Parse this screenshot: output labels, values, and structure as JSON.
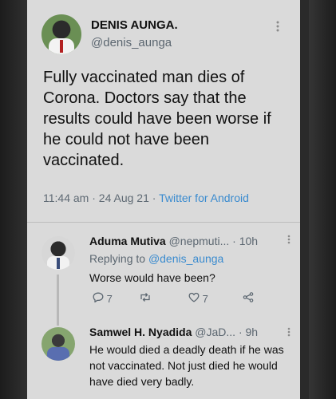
{
  "tweet": {
    "author_name": "DENIS AUNGA.",
    "author_handle": "@denis_aunga",
    "text": "Fully vaccinated man dies of Corona. Doctors say that the results could have been worse if he could not have been vaccinated.",
    "time": "11:44 am",
    "date": "24 Aug 21",
    "source": "Twitter for Android",
    "separator": "·"
  },
  "replies": [
    {
      "name": "Aduma Mutiva",
      "handle": "@nepmuti...",
      "time": "· 10h",
      "replying_label": "Replying to",
      "replying_handle": "@denis_aunga",
      "text": "Worse would have been?",
      "reply_count": "7",
      "like_count": "7"
    },
    {
      "name": "Samwel H. Nyadida",
      "handle": "@JaD...",
      "time": "· 9h",
      "text": "He would died a deadly death if he was not vaccinated. Not just died he would have died very badly."
    }
  ],
  "icons": {
    "more": "more-vert-icon",
    "reply": "reply-bubble-icon",
    "retweet": "retweet-icon",
    "like": "heart-icon",
    "share": "share-icon"
  },
  "colors": {
    "link": "#3a8bcf",
    "secondary_text": "#5b6670",
    "screen_bg": "#dadada"
  }
}
